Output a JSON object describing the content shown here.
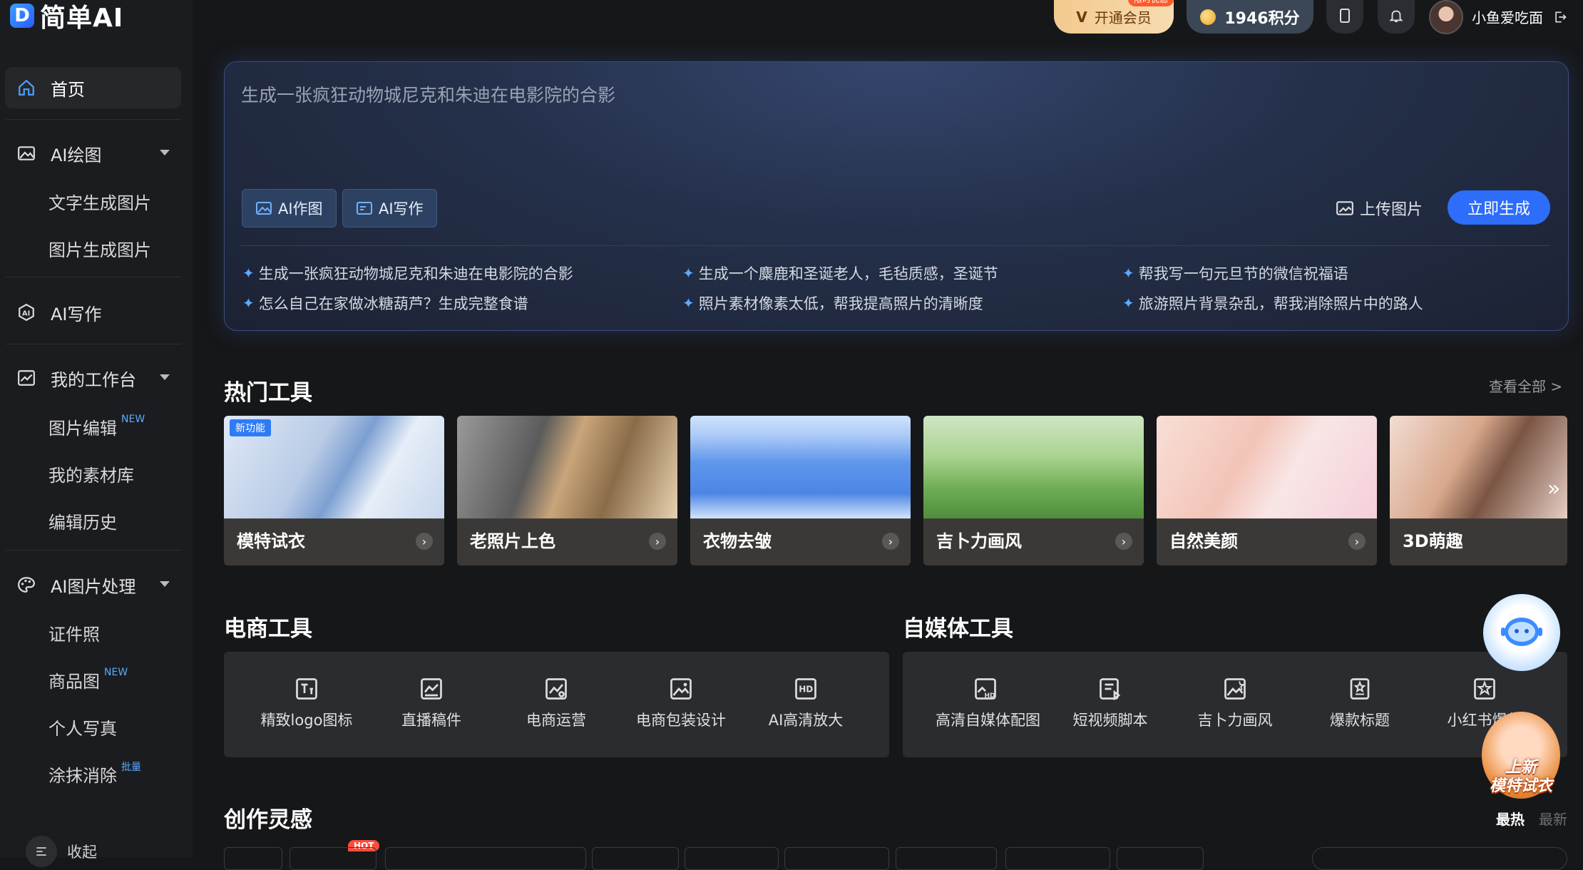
{
  "brand": {
    "mark": "D",
    "name": "简单AI"
  },
  "sidebar": {
    "home": "首页",
    "ai_draw": "AI绘图",
    "text_to_image": "文字生成图片",
    "image_to_image": "图片生成图片",
    "ai_writing": "AI写作",
    "workbench": "我的工作台",
    "image_edit": "图片编辑",
    "image_edit_badge": "NEW",
    "materials": "我的素材库",
    "edit_history": "编辑历史",
    "ai_image_process": "AI图片处理",
    "id_photo": "证件照",
    "product_image": "商品图",
    "product_image_badge": "NEW",
    "portrait": "个人写真",
    "erase": "涂抹消除",
    "erase_badge": "批量",
    "collapse": "收起"
  },
  "topbar": {
    "vip_label": "开通会员",
    "vip_tag": "限时优惠",
    "points": "1946积分",
    "username": "小鱼爱吃面"
  },
  "prompt": {
    "placeholder": "生成一张疯狂动物城尼克和朱迪在电影院的合影",
    "chip_draw": "AI作图",
    "chip_write": "AI写作",
    "upload": "上传图片",
    "generate": "立即生成",
    "suggestions": [
      "生成一张疯狂动物城尼克和朱迪在电影院的合影",
      "生成一个麋鹿和圣诞老人，毛毡质感，圣诞节",
      "帮我写一句元旦节的微信祝福语",
      "怎么自己在家做冰糖葫芦？生成完整食谱",
      "照片素材像素太低，帮我提高照片的清晰度",
      "旅游照片背景杂乱，帮我消除照片中的路人"
    ]
  },
  "hot_tools": {
    "title": "热门工具",
    "see_all": "查看全部 >",
    "new_tag": "新功能",
    "items": [
      "模特试衣",
      "老照片上色",
      "衣物去皱",
      "吉卜力画风",
      "自然美颜",
      "3D萌趣"
    ]
  },
  "ecommerce": {
    "title": "电商工具",
    "items": [
      "精致logo图标",
      "直播稿件",
      "电商运营",
      "电商包装设计",
      "AI高清放大"
    ]
  },
  "media": {
    "title": "自媒体工具",
    "items": [
      "高清自媒体配图",
      "短视频脚本",
      "吉卜力画风",
      "爆款标题",
      "小红书爆款"
    ]
  },
  "inspiration": {
    "title": "创作灵感",
    "sort_hot": "最热",
    "sort_new": "最新",
    "hot_badge": "HOT"
  },
  "promo": {
    "line1": "上新",
    "line2": "模特试衣"
  },
  "colors": {
    "accent": "#2d6dfa",
    "vip": "#f3c98e",
    "new_badge": "#5aa9ff"
  }
}
